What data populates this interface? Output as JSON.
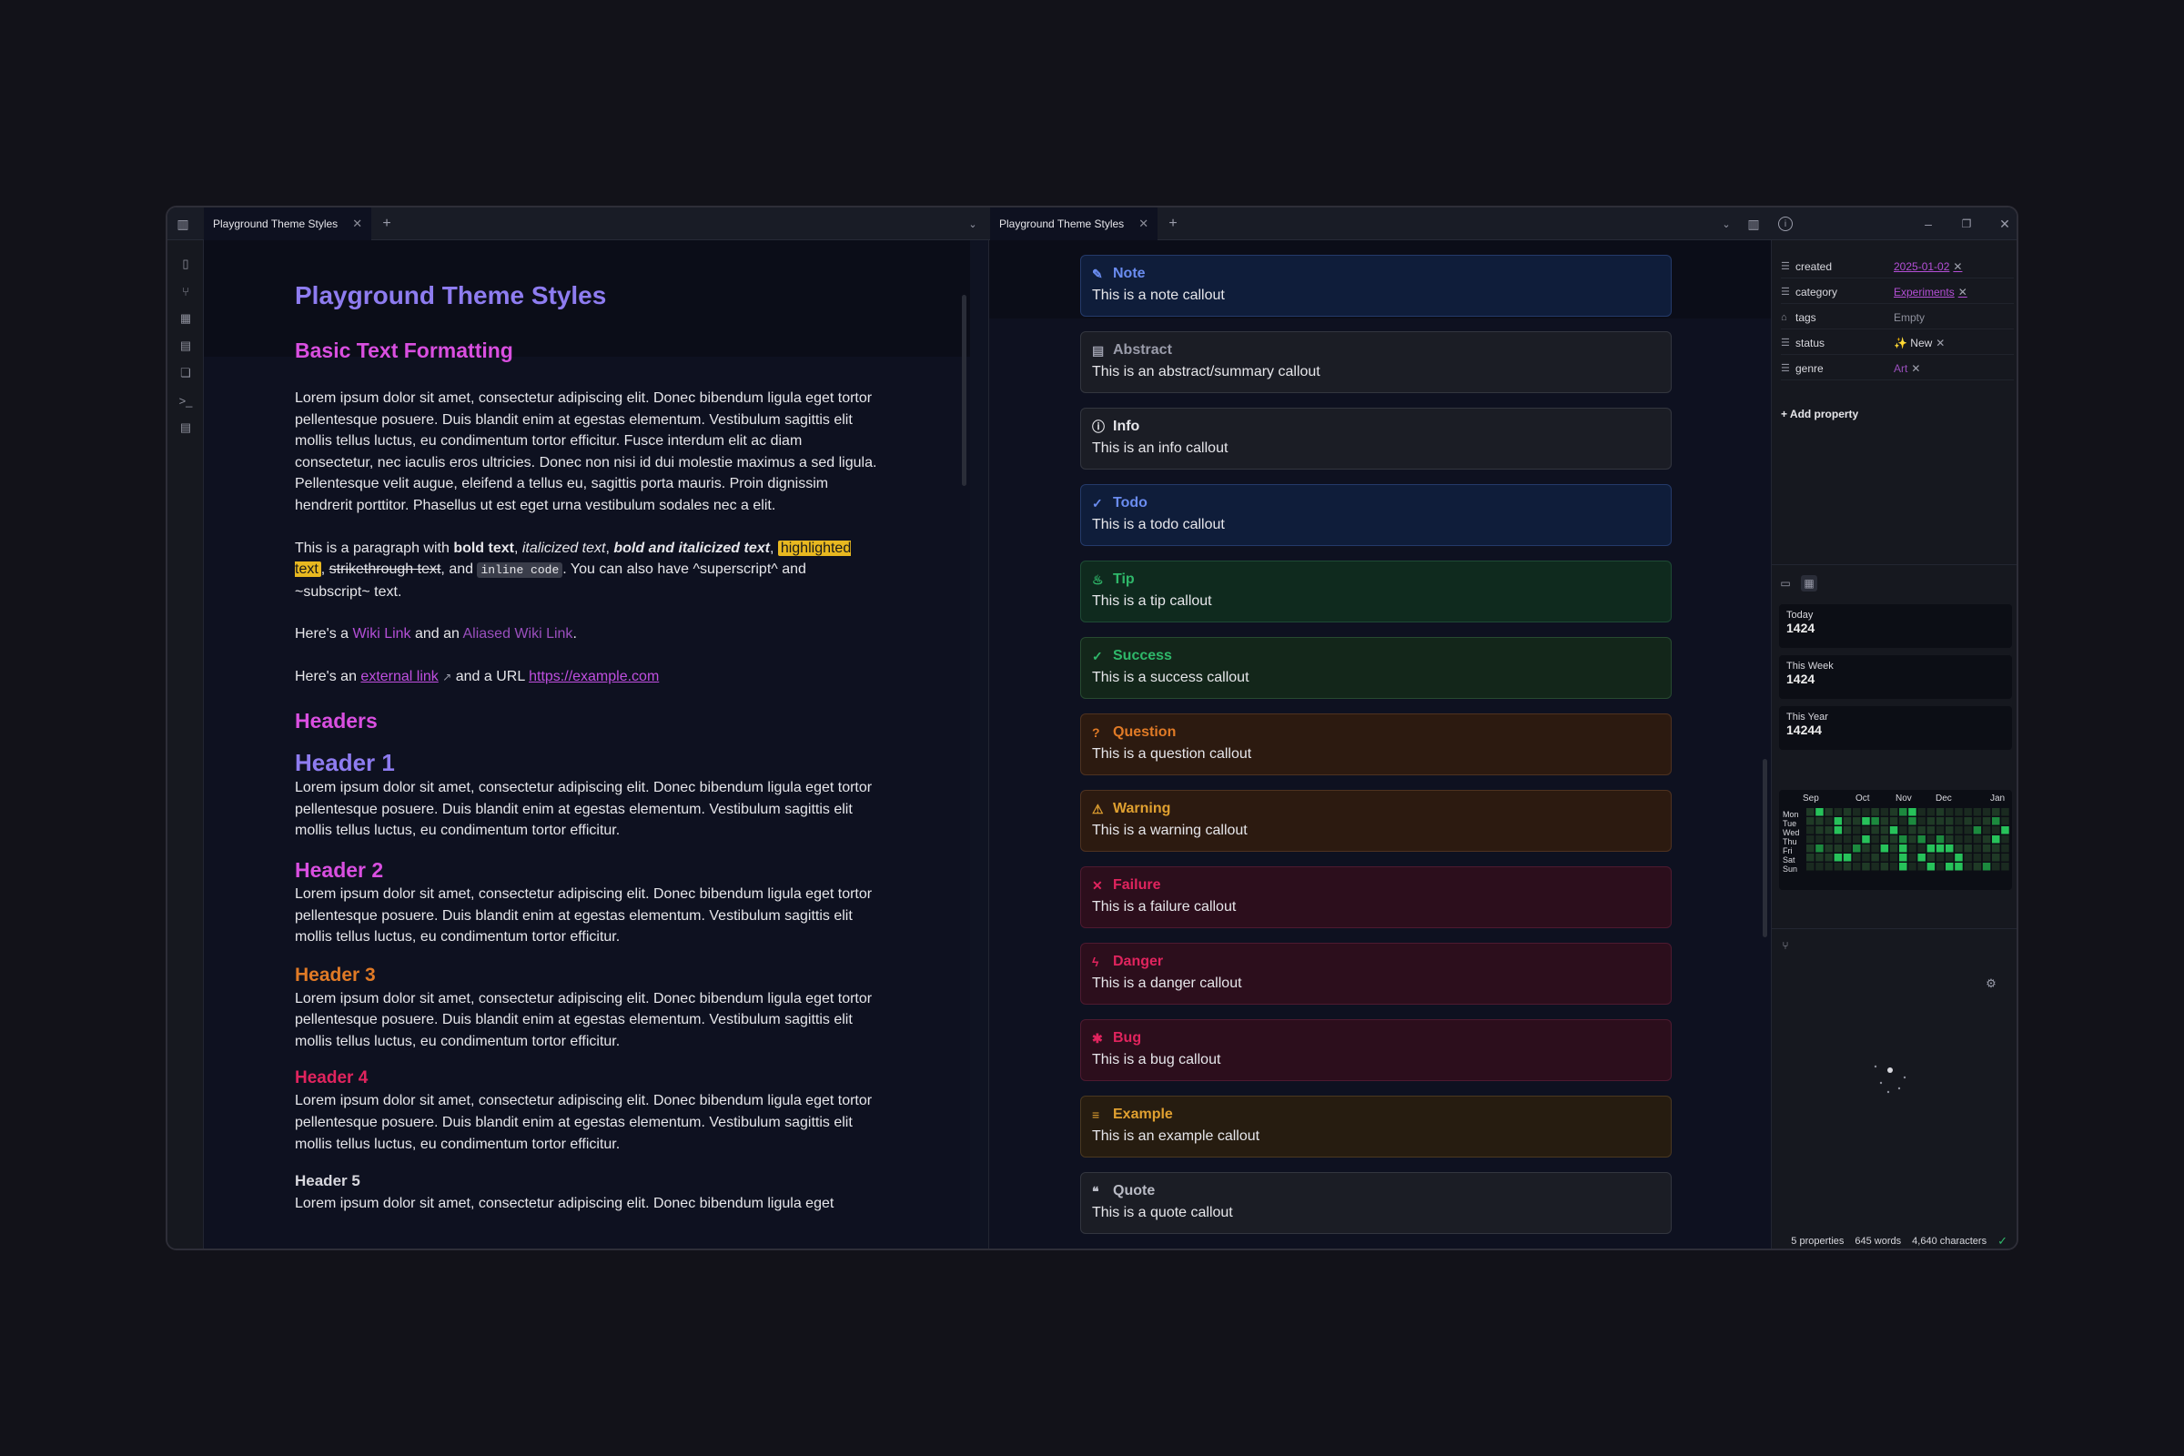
{
  "window": {
    "left_tab": "Playground Theme Styles",
    "right_tab": "Playground Theme Styles"
  },
  "doc": {
    "title": "Playground Theme Styles",
    "basic_heading": "Basic Text Formatting",
    "lorem_long": "Lorem ipsum dolor sit amet, consectetur adipiscing elit. Donec bibendum ligula eget tortor pellentesque posuere. Duis blandit enim at egestas elementum. Vestibulum sagittis elit mollis tellus luctus, eu condimentum tortor efficitur. Fusce interdum elit ac diam consectetur, nec iaculis eros ultricies. Donec non nisi id dui molestie maximus a sed ligula. Pellentesque velit augue, eleifend a tellus eu, sagittis porta mauris. Proin dignissim hendrerit porttitor. Phasellus ut est eget urna vestibulum sodales nec a elit.",
    "fmt_intro": "This is a paragraph with ",
    "fmt_bold": "bold text",
    "fmt_italic": "italicized text",
    "fmt_bolditalic": "bold and italicized text",
    "fmt_highlight": "highlighted text",
    "fmt_strike": "strikethrough text",
    "fmt_and": ", and ",
    "fmt_code": "inline code",
    "fmt_tail": ". You can also have ^superscript^ and ~subscript~ text.",
    "wiki_pre": "Here's a ",
    "wiki_link": "Wiki Link",
    "wiki_mid": " and an ",
    "wiki_alias": "Aliased Wiki Link",
    "ext_pre": "Here's an ",
    "ext_link": "external link",
    "ext_mid": " and a URL ",
    "ext_url": "https://example.com",
    "headers_heading": "Headers",
    "lorem_short": "Lorem ipsum dolor sit amet, consectetur adipiscing elit. Donec bibendum ligula eget tortor pellentesque posuere. Duis blandit enim at egestas elementum. Vestibulum sagittis elit mollis tellus luctus, eu condimentum tortor efficitur.",
    "h1": "Header 1",
    "h2": "Header 2",
    "h3": "Header 3",
    "h4": "Header 4",
    "h5": "Header 5",
    "lorem_cut": "Lorem ipsum dolor sit amet, consectetur adipiscing elit. Donec bibendum ligula eget"
  },
  "callouts": [
    {
      "title": "Note",
      "body": "This is a note callout",
      "icon": "pencil-icon",
      "color": "#6a8cf0",
      "bg": "#0f1d3a",
      "border": "#243a6a"
    },
    {
      "title": "Abstract",
      "body": "This is an abstract/summary callout",
      "icon": "clipboard-icon",
      "color": "#9a9caa",
      "bg": "#1b1d25",
      "border": "#33363f"
    },
    {
      "title": "Info",
      "body": "This is an info callout",
      "icon": "info-icon",
      "color": "#e6e6ea",
      "bg": "#1b1d25",
      "border": "#33363f"
    },
    {
      "title": "Todo",
      "body": "This is a todo callout",
      "icon": "check-circle-icon",
      "color": "#6a8cf0",
      "bg": "#0f1d3a",
      "border": "#243a6a"
    },
    {
      "title": "Tip",
      "body": "This is a tip callout",
      "icon": "flame-icon",
      "color": "#2fb86a",
      "bg": "#0f2a1e",
      "border": "#1e4a34"
    },
    {
      "title": "Success",
      "body": "This is a success callout",
      "icon": "check-icon",
      "color": "#2fb86a",
      "bg": "#13261a",
      "border": "#274a30"
    },
    {
      "title": "Question",
      "body": "This is a question callout",
      "icon": "help-circle-icon",
      "color": "#e07a26",
      "bg": "#2c1a10",
      "border": "#4e3220"
    },
    {
      "title": "Warning",
      "body": "This is a warning callout",
      "icon": "alert-triangle-icon",
      "color": "#e0a030",
      "bg": "#2c1a10",
      "border": "#4e3220"
    },
    {
      "title": "Failure",
      "body": "This is a failure callout",
      "icon": "x-icon",
      "color": "#e0245e",
      "bg": "#2c0e1c",
      "border": "#4e1a30"
    },
    {
      "title": "Danger",
      "body": "This is a danger callout",
      "icon": "zap-icon",
      "color": "#e0245e",
      "bg": "#2c0e1c",
      "border": "#4e1a30"
    },
    {
      "title": "Bug",
      "body": "This is a bug callout",
      "icon": "bug-icon",
      "color": "#e0245e",
      "bg": "#2c0e1c",
      "border": "#4e1a30"
    },
    {
      "title": "Example",
      "body": "This is an example callout",
      "icon": "list-icon",
      "color": "#e0a030",
      "bg": "#261c10",
      "border": "#4a3820"
    },
    {
      "title": "Quote",
      "body": "This is a quote callout",
      "icon": "quote-icon",
      "color": "#b8bac4",
      "bg": "#1b1d25",
      "border": "#33363f"
    }
  ],
  "properties": [
    {
      "key": "created",
      "value": "2025-01-02",
      "style": "link",
      "removable": true
    },
    {
      "key": "category",
      "value": "Experiments",
      "style": "link",
      "removable": true
    },
    {
      "key": "tags",
      "value": "Empty",
      "style": "muted",
      "removable": false
    },
    {
      "key": "status",
      "value": "✨ New",
      "style": "plain",
      "removable": true
    },
    {
      "key": "genre",
      "value": "Art",
      "style": "art",
      "removable": true
    }
  ],
  "add_property": "+ Add property",
  "stats": [
    {
      "label": "Today",
      "value": "1424"
    },
    {
      "label": "This Week",
      "value": "1424"
    },
    {
      "label": "This Year",
      "value": "14244"
    }
  ],
  "heatmap": {
    "months": [
      "Sep",
      "Oct",
      "Nov",
      "Dec",
      "Jan"
    ],
    "days": [
      "Mon",
      "Tue",
      "Wed",
      "Thu",
      "Fri",
      "Sat",
      "Sun"
    ]
  },
  "statusbar": {
    "properties": "5 properties",
    "words": "645 words",
    "chars": "4,640 characters"
  }
}
